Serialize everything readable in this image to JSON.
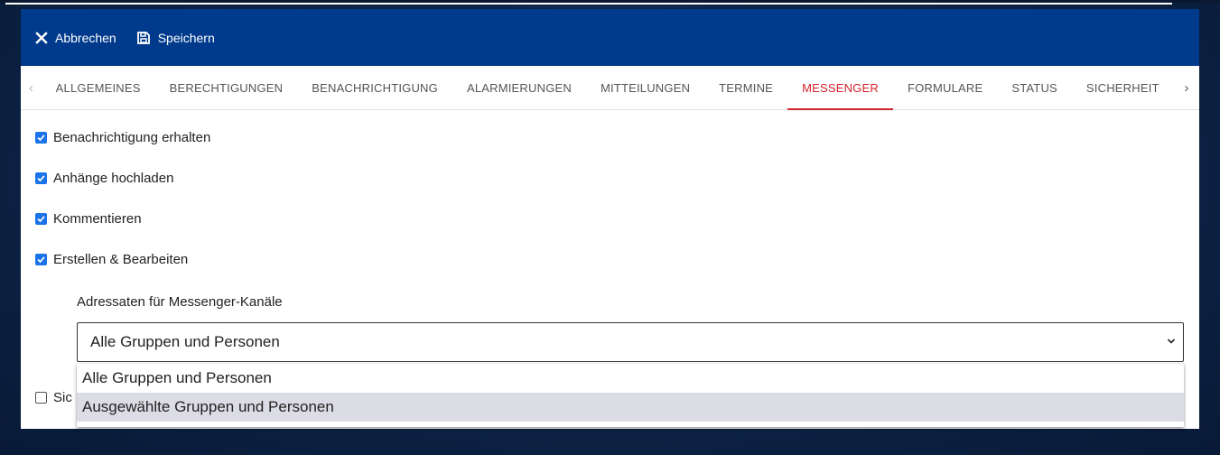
{
  "toolbar": {
    "cancel_label": "Abbrechen",
    "save_label": "Speichern"
  },
  "tabs": [
    {
      "label": "ALLGEMEINES",
      "active": false
    },
    {
      "label": "BERECHTIGUNGEN",
      "active": false
    },
    {
      "label": "BENACHRICHTIGUNG",
      "active": false
    },
    {
      "label": "ALARMIERUNGEN",
      "active": false
    },
    {
      "label": "MITTEILUNGEN",
      "active": false
    },
    {
      "label": "TERMINE",
      "active": false
    },
    {
      "label": "MESSENGER",
      "active": true
    },
    {
      "label": "FORMULARE",
      "active": false
    },
    {
      "label": "STATUS",
      "active": false
    },
    {
      "label": "SICHERHEIT",
      "active": false
    }
  ],
  "checkboxes": [
    {
      "label": "Benachrichtigung erhalten",
      "checked": true
    },
    {
      "label": "Anhänge hochladen",
      "checked": true
    },
    {
      "label": "Kommentieren",
      "checked": true
    },
    {
      "label": "Erstellen & Bearbeiten",
      "checked": true
    }
  ],
  "recipients": {
    "label": "Adressaten für Messenger-Kanäle",
    "selected": "Alle Gruppen und Personen",
    "options": [
      "Alle Gruppen und Personen",
      "Ausgewählte Gruppen und Personen"
    ]
  },
  "partial_checkbox": {
    "label": "Sic",
    "checked": false
  },
  "colors": {
    "header": "#003a8c",
    "active_tab": "#d3222a",
    "checkbox": "#1a73e8"
  }
}
